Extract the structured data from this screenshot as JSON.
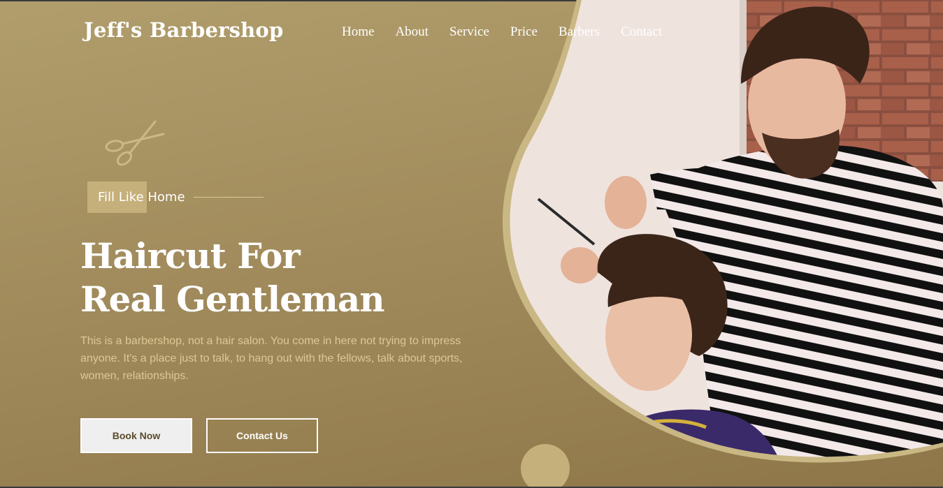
{
  "brand": {
    "name": "Jeff's Barbershop"
  },
  "nav": {
    "items": [
      "Home",
      "About",
      "Service",
      "Price",
      "Barbers",
      "Contact"
    ]
  },
  "hero": {
    "tagline": "Fill Like Home",
    "headline_line1": "Haircut For",
    "headline_line2": "Real Gentleman",
    "description": "This is a barbershop, not a hair salon. You come in here not trying to impress anyone. It's a place just to talk, to hang out with the fellows, talk about sports, women, relationships.",
    "book_label": "Book Now",
    "contact_label": "Contact Us"
  },
  "colors": {
    "background": "#a28c5d",
    "accent": "#c5b07b",
    "description_text": "#dcc897"
  },
  "icons": {
    "decor": "scissors-icon"
  }
}
